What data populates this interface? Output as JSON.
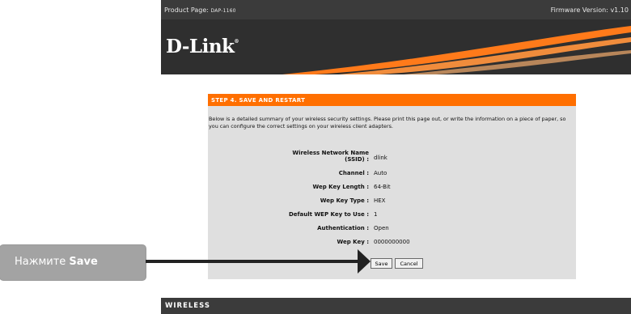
{
  "header": {
    "product_label": "Product Page: ",
    "product_model": "DAP-1160",
    "firmware": "Firmware Version: v1.10"
  },
  "brand": {
    "logo": "D-Link",
    "logo_mark": "®"
  },
  "panel": {
    "title": "STEP 4. SAVE AND RESTART",
    "description": "Below is a detailed summary of your wireless security settings. Please print this page out, or write the information on a piece of paper, so you can configure the correct settings on your wireless client adapters."
  },
  "settings": [
    {
      "label": "Wireless Network Name (SSID) :",
      "value": "dlink"
    },
    {
      "label": "Channel :",
      "value": "Auto"
    },
    {
      "label": "Wep Key Length :",
      "value": "64-Bit"
    },
    {
      "label": "Wep Key Type :",
      "value": "HEX"
    },
    {
      "label": "Default WEP Key to Use :",
      "value": "1"
    },
    {
      "label": "Authentication :",
      "value": "Open"
    },
    {
      "label": "Wep Key :",
      "value": "0000000000"
    }
  ],
  "buttons": {
    "save": "Save",
    "cancel": "Cancel"
  },
  "footer": {
    "label": "WIRELESS"
  },
  "callout": {
    "prefix": "Нажмите ",
    "bold": "Save"
  },
  "colors": {
    "accent": "#ff6f00",
    "bar": "#3b3b3b",
    "panel": "#dfdfdf"
  }
}
